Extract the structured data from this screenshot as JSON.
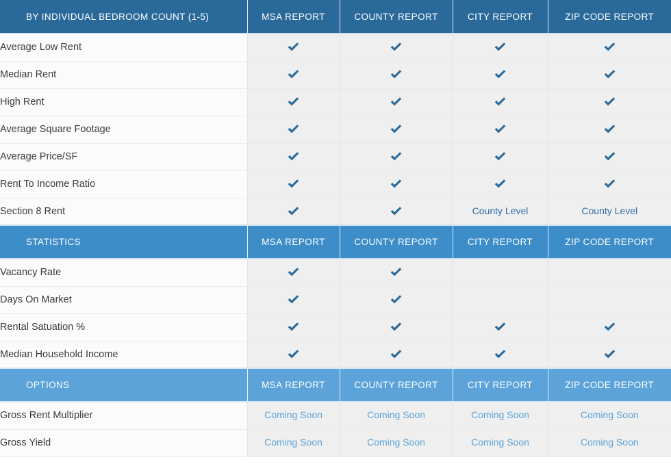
{
  "columns": [
    "MSA REPORT",
    "COUNTY  REPORT",
    "CITY REPORT",
    "ZIP CODE REPORT"
  ],
  "icons": {
    "check": "check-icon"
  },
  "colors": {
    "header_dark": "#2a6a9b",
    "header_mid": "#3c8dc8",
    "header_light": "#5ba3d8",
    "check": "#2a6a9b",
    "note_county": "#2d6da4",
    "note_soon": "#5ba3d8",
    "row_label_bg": "#fbfbfb",
    "row_value_bg": "#efefef"
  },
  "sections": [
    {
      "title": "BY INDIVIDUAL BEDROOM COUNT (1-5)",
      "tone": "dark",
      "columns": [
        "MSA REPORT",
        "COUNTY  REPORT",
        "CITY REPORT",
        "ZIP CODE REPORT"
      ],
      "rows": [
        {
          "label": "Average Low Rent",
          "cells": [
            "check",
            "check",
            "check",
            "check"
          ]
        },
        {
          "label": "Median Rent",
          "cells": [
            "check",
            "check",
            "check",
            "check"
          ]
        },
        {
          "label": "High Rent",
          "cells": [
            "check",
            "check",
            "check",
            "check"
          ]
        },
        {
          "label": "Average Square Footage",
          "cells": [
            "check",
            "check",
            "check",
            "check"
          ]
        },
        {
          "label": "Average Price/SF",
          "cells": [
            "check",
            "check",
            "check",
            "check"
          ]
        },
        {
          "label": "Rent To Income Ratio",
          "cells": [
            "check",
            "check",
            "check",
            "check"
          ]
        },
        {
          "label": "Section 8 Rent",
          "cells": [
            "check",
            "check",
            "County Level",
            "County Level"
          ]
        }
      ]
    },
    {
      "title": "STATISTICS",
      "tone": "mid",
      "columns": [
        "MSA REPORT",
        "COUNTY  REPORT",
        "CITY REPORT",
        "ZIP CODE REPORT"
      ],
      "rows": [
        {
          "label": "Vacancy Rate",
          "cells": [
            "check",
            "check",
            "",
            ""
          ]
        },
        {
          "label": "Days On Market",
          "cells": [
            "check",
            "check",
            "",
            ""
          ]
        },
        {
          "label": "Rental Satuation %",
          "cells": [
            "check",
            "check",
            "check",
            "check"
          ]
        },
        {
          "label": "Median Household Income",
          "cells": [
            "check",
            "check",
            "check",
            "check"
          ]
        }
      ]
    },
    {
      "title": "OPTIONS",
      "tone": "light",
      "columns": [
        "MSA REPORT",
        "COUNTY  REPORT",
        "CITY REPORT",
        "ZIP CODE REPORT"
      ],
      "rows": [
        {
          "label": "Gross Rent Multiplier",
          "cells": [
            "Coming Soon",
            "Coming Soon",
            "Coming Soon",
            "Coming Soon"
          ]
        },
        {
          "label": "Gross Yield",
          "cells": [
            "Coming Soon",
            "Coming Soon",
            "Coming Soon",
            "Coming Soon"
          ]
        }
      ]
    }
  ]
}
